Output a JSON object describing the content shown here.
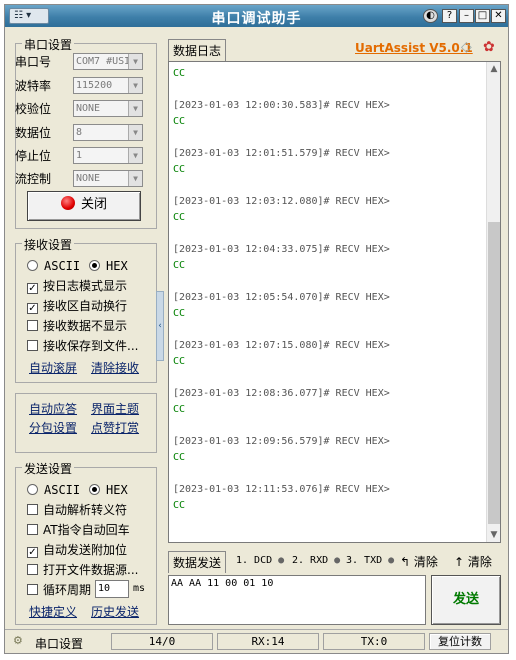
{
  "window": {
    "title": "串口调试助手",
    "sys_menu": "☷ ▾"
  },
  "titlebar_buttons": {
    "pin": "◐",
    "help": "?",
    "minimize": "–",
    "maximize": "□",
    "close": "✕"
  },
  "serial_settings": {
    "group_label": "串口设置",
    "port_label": "串口号",
    "port_value": "COM7 #USI",
    "baud_label": "波特率",
    "baud_value": "115200",
    "parity_label": "校验位",
    "parity_value": "NONE",
    "databits_label": "数据位",
    "databits_value": "8",
    "stopbits_label": "停止位",
    "stopbits_value": "1",
    "flow_label": "流控制",
    "flow_value": "NONE",
    "close_button": "关闭"
  },
  "receive_settings": {
    "group_label": "接收设置",
    "ascii": "ASCII",
    "hex": "HEX",
    "log_mode": "按日志模式显示",
    "auto_wrap": "接收区自动换行",
    "hide_data": "接收数据不显示",
    "save_to_file": "接收保存到文件...",
    "auto_scroll": "自动滚屏",
    "clear_receive": "清除接收"
  },
  "tools": {
    "auto_reply": "自动应答",
    "theme": "界面主题",
    "packet_settings": "分包设置",
    "tip": "点赞打赏"
  },
  "send_settings": {
    "group_label": "发送设置",
    "ascii": "ASCII",
    "hex": "HEX",
    "parse_escape": "自动解析转义符",
    "at_cr": "AT指令自动回车",
    "append_check": "自动发送附加位",
    "open_file": "打开文件数据源...",
    "loop_label": "循环周期",
    "loop_value": "10",
    "loop_unit": "ms",
    "shortcut": "快捷定义",
    "history": "历史发送"
  },
  "log": {
    "tab_label": "数据日志",
    "brand": "UartAssist V5.0.1",
    "first_data": "CC",
    "entries": [
      {
        "header": "[2023-01-03 12:00:30.583]# RECV HEX>",
        "data": "CC"
      },
      {
        "header": "[2023-01-03 12:01:51.579]# RECV HEX>",
        "data": "CC"
      },
      {
        "header": "[2023-01-03 12:03:12.080]# RECV HEX>",
        "data": "CC"
      },
      {
        "header": "[2023-01-03 12:04:33.075]# RECV HEX>",
        "data": "CC"
      },
      {
        "header": "[2023-01-03 12:05:54.070]# RECV HEX>",
        "data": "CC"
      },
      {
        "header": "[2023-01-03 12:07:15.080]# RECV HEX>",
        "data": "CC"
      },
      {
        "header": "[2023-01-03 12:08:36.077]# RECV HEX>",
        "data": "CC"
      },
      {
        "header": "[2023-01-03 12:09:56.579]# RECV HEX>",
        "data": "CC"
      },
      {
        "header": "[2023-01-03 12:11:53.076]# RECV HEX>",
        "data": "CC"
      }
    ]
  },
  "send_area": {
    "tab_label": "数据发送",
    "dcd": "1. DCD",
    "rxd": "2. RXD",
    "txd": "3. TXD",
    "clear1": "清除",
    "clear2": "清除",
    "input_value": "AA AA 11 00 01 10",
    "send_button": "发送"
  },
  "status_bar": {
    "port_label": "串口设置",
    "counter": "14/0",
    "rx": "RX:14",
    "tx": "TX:0",
    "reset": "复位计数"
  }
}
